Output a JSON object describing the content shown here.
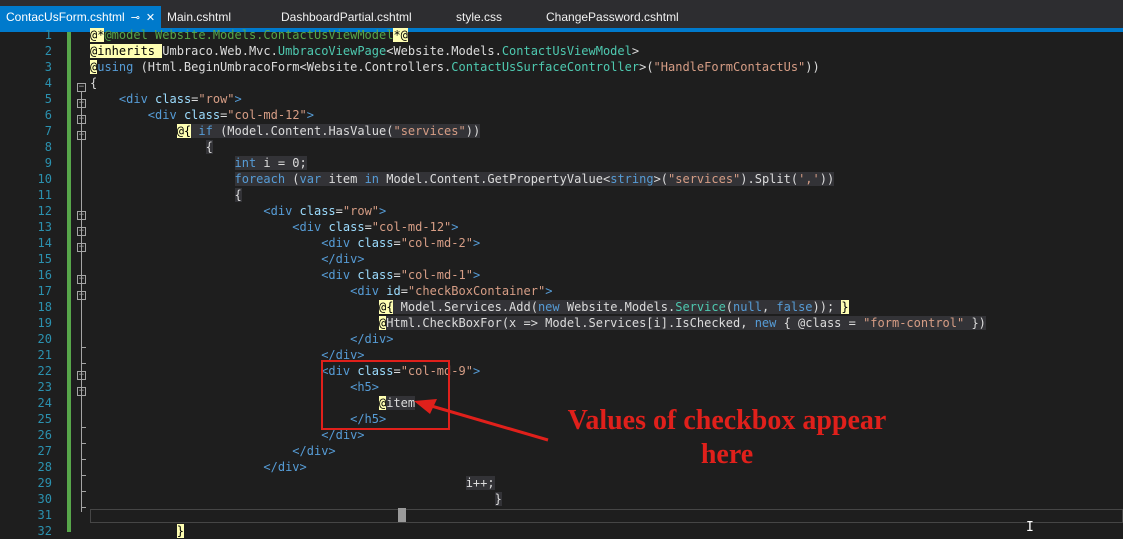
{
  "tabs": [
    {
      "label": "ContacUsForm.cshtml",
      "active": true,
      "pin": "⊸",
      "close": "✕"
    },
    {
      "label": "Main.cshtml"
    },
    {
      "label": "DashboardPartial.cshtml"
    },
    {
      "label": "style.css"
    },
    {
      "label": "ChangePassword.cshtml"
    }
  ],
  "line_numbers": [
    "1",
    "2",
    "3",
    "4",
    "5",
    "6",
    "7",
    "8",
    "9",
    "10",
    "11",
    "12",
    "13",
    "14",
    "15",
    "16",
    "17",
    "18",
    "19",
    "20",
    "21",
    "22",
    "23",
    "24",
    "25",
    "26",
    "27",
    "28",
    "29",
    "30",
    "31",
    "32"
  ],
  "annotation": {
    "line1": "Values of checkbox appear",
    "line2": "here"
  },
  "colors": {
    "accent": "#007acc",
    "annotation": "#e0201b",
    "change_bar": "#57a64a"
  }
}
